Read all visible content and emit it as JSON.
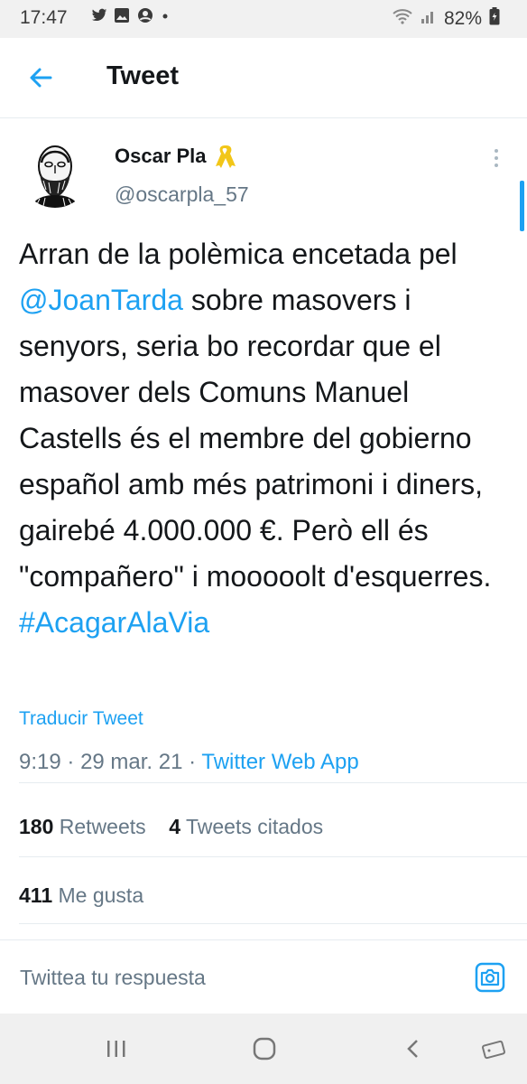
{
  "status_bar": {
    "time": "17:47",
    "battery": "82%",
    "notification_icons": [
      "twitter-icon",
      "gallery-icon",
      "account-icon"
    ]
  },
  "header": {
    "title": "Tweet"
  },
  "tweet": {
    "author_name": "Oscar Pla",
    "author_handle": "@oscarpla_57",
    "text_parts": {
      "p1": "Arran de la polèmica encetada pel ",
      "mention": "@JoanTarda",
      "p2": " sobre masovers i senyors, seria bo recordar que el masover dels Comuns Manuel Castells és el membre del gobierno español amb més patrimoni i diners, gairebé 4.000.000 €. Però ell és \"compañero\" i mooooolt d'esquerres. ",
      "hashtag": "#AcagarAlaVia"
    },
    "translate_label": "Traducir Tweet",
    "time": "9:19",
    "date": "29 mar. 21",
    "source": "Twitter Web App"
  },
  "stats": {
    "retweets_count": "180",
    "retweets_label": "Retweets",
    "quotes_count": "4",
    "quotes_label": "Tweets citados",
    "likes_count": "411",
    "likes_label": "Me gusta"
  },
  "reply": {
    "placeholder": "Twittea tu respuesta"
  },
  "colors": {
    "accent": "#1da1f2",
    "ribbon": "#f2c618",
    "muted": "#657786"
  }
}
